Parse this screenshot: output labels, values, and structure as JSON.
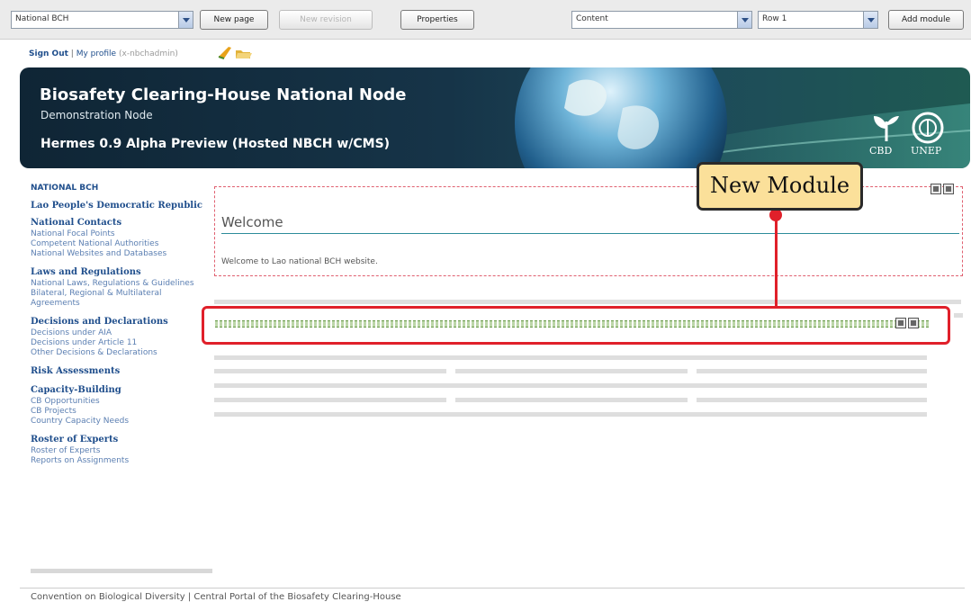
{
  "toolbar": {
    "site_select": "National BCH",
    "new_page": "New page",
    "new_revision": "New revision",
    "properties": "Properties",
    "zone_select": "Content",
    "row_select": "Row 1",
    "add_module": "Add module"
  },
  "user": {
    "sign_out": "Sign Out",
    "separator": "|",
    "my_profile": "My profile",
    "username": "(x-nbchadmin)"
  },
  "banner": {
    "title": "Biosafety Clearing-House National Node",
    "subtitle": "Demonstration Node",
    "version": "Hermes 0.9 Alpha Preview (Hosted NBCH w/CMS)",
    "logos": [
      {
        "label": "CBD",
        "icon": "cbd-leaf-icon"
      },
      {
        "label": "UNEP",
        "icon": "unep-emblem-icon"
      }
    ]
  },
  "sidebar": {
    "root": "NATIONAL BCH",
    "country": "Lao People's Democratic Republic",
    "groups": [
      {
        "heading": "National Contacts",
        "links": [
          "National Focal Points",
          "Competent National Authorities",
          "National Websites and Databases"
        ]
      },
      {
        "heading": "Laws and Regulations",
        "links": [
          "National Laws, Regulations & Guidelines",
          "Bilateral, Regional & Multilateral Agreements"
        ]
      },
      {
        "heading": "Decisions and Declarations",
        "links": [
          "Decisions under AIA",
          "Decisions under Article 11",
          "Other Decisions & Declarations"
        ]
      },
      {
        "heading": "Risk Assessments",
        "links": []
      },
      {
        "heading": "Capacity-Building",
        "links": [
          "CB Opportunities",
          "CB Projects",
          "Country Capacity Needs"
        ]
      },
      {
        "heading": "Roster of Experts",
        "links": [
          "Roster of Experts",
          "Reports on Assignments"
        ]
      }
    ]
  },
  "welcome_module": {
    "title": "Welcome",
    "text": "Welcome to Lao national BCH website."
  },
  "callout": {
    "label": "New Module"
  },
  "footer": {
    "cbd": "Convention on Biological Diversity",
    "separator": "|",
    "portal": "Central Portal of the Biosafety Clearing-House"
  },
  "colors": {
    "accent_red": "#e0202a",
    "link_blue": "#1f4e8c",
    "callout_yellow": "#fbe09a"
  }
}
